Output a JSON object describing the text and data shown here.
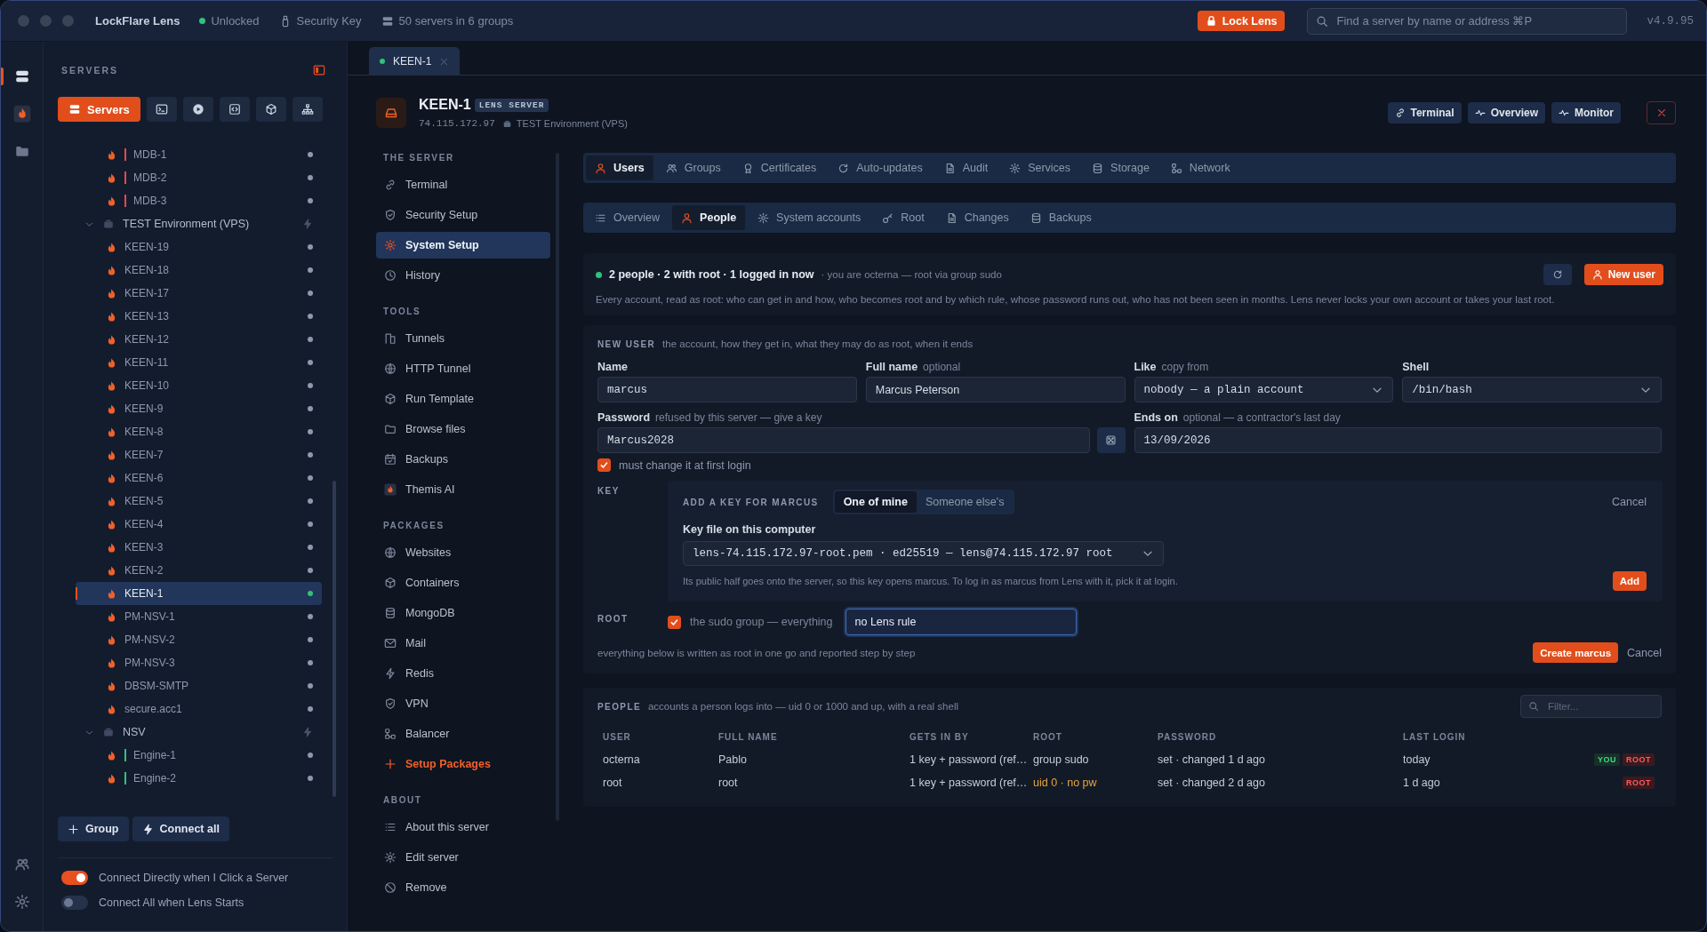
{
  "titlebar": {
    "app_name": "LockFlare Lens",
    "status": "Unlocked",
    "key_label": "Security Key",
    "servers_summary": "50 servers in 6 groups",
    "lock_button": "Lock Lens",
    "search": {
      "placeholder": "Find a server by name or address ⌘P"
    },
    "version": "v4.9.95"
  },
  "rail": [
    {
      "kind": "servers",
      "selected": true
    },
    {
      "kind": "themis",
      "selected": false
    },
    {
      "kind": "files",
      "selected": false
    }
  ],
  "rail_bottom": [
    {
      "kind": "people"
    },
    {
      "kind": "settings"
    }
  ],
  "sidebar": {
    "title": "SERVERS",
    "modes": [
      {
        "kind": "servers",
        "label": "Servers",
        "selected": true
      },
      {
        "kind": "terminal",
        "selected": false
      },
      {
        "kind": "play",
        "selected": false
      },
      {
        "kind": "code",
        "selected": false
      },
      {
        "kind": "cube",
        "selected": false
      },
      {
        "kind": "hierarchy",
        "selected": false
      }
    ],
    "tree": [
      {
        "kind": "server",
        "name": "MDB-1",
        "color": "#e5484d",
        "connected": false,
        "selected": false
      },
      {
        "kind": "server",
        "name": "MDB-2",
        "color": "#e5484d",
        "connected": false,
        "selected": false
      },
      {
        "kind": "server",
        "name": "MDB-3",
        "color": "#e5484d",
        "connected": false,
        "selected": false
      },
      {
        "kind": "group",
        "name": "TEST Environment (VPS)",
        "expanded": true,
        "children": [
          {
            "kind": "server",
            "name": "KEEN-19",
            "connected": false,
            "selected": false
          },
          {
            "kind": "server",
            "name": "KEEN-18",
            "connected": false,
            "selected": false
          },
          {
            "kind": "server",
            "name": "KEEN-17",
            "connected": false,
            "selected": false
          },
          {
            "kind": "server",
            "name": "KEEN-13",
            "connected": false,
            "selected": false
          },
          {
            "kind": "server",
            "name": "KEEN-12",
            "connected": false,
            "selected": false
          },
          {
            "kind": "server",
            "name": "KEEN-11",
            "connected": false,
            "selected": false
          },
          {
            "kind": "server",
            "name": "KEEN-10",
            "connected": false,
            "selected": false
          },
          {
            "kind": "server",
            "name": "KEEN-9",
            "connected": false,
            "selected": false
          },
          {
            "kind": "server",
            "name": "KEEN-8",
            "connected": false,
            "selected": false
          },
          {
            "kind": "server",
            "name": "KEEN-7",
            "connected": false,
            "selected": false
          },
          {
            "kind": "server",
            "name": "KEEN-6",
            "connected": false,
            "selected": false
          },
          {
            "kind": "server",
            "name": "KEEN-5",
            "connected": false,
            "selected": false
          },
          {
            "kind": "server",
            "name": "KEEN-4",
            "connected": false,
            "selected": false
          },
          {
            "kind": "server",
            "name": "KEEN-3",
            "connected": false,
            "selected": false
          },
          {
            "kind": "server",
            "name": "KEEN-2",
            "connected": false,
            "selected": false
          },
          {
            "kind": "server",
            "name": "KEEN-1",
            "connected": true,
            "selected": true
          },
          {
            "kind": "server",
            "name": "PM-NSV-1",
            "connected": false,
            "selected": false
          },
          {
            "kind": "server",
            "name": "PM-NSV-2",
            "connected": false,
            "selected": false
          },
          {
            "kind": "server",
            "name": "PM-NSV-3",
            "connected": false,
            "selected": false
          },
          {
            "kind": "server",
            "name": "DBSM-SMTP",
            "connected": false,
            "selected": false
          },
          {
            "kind": "server",
            "name": "secure.acc1",
            "connected": false,
            "selected": false
          }
        ]
      },
      {
        "kind": "group",
        "name": "NSV",
        "expanded": true,
        "children": [
          {
            "kind": "server",
            "name": "Engine-1",
            "color": "#2fc27a",
            "connected": false,
            "selected": false
          },
          {
            "kind": "server",
            "name": "Engine-2",
            "color": "#2fc27a",
            "connected": false,
            "selected": false
          }
        ]
      }
    ],
    "buttons": [
      {
        "kind": "plus",
        "label": "Group"
      },
      {
        "kind": "bolt",
        "label": "Connect all"
      }
    ],
    "toggles": [
      {
        "label": "Connect Directly when I Click a Server",
        "on": true
      },
      {
        "label": "Connect All when Lens Starts",
        "on": false
      }
    ]
  },
  "tabs": [
    {
      "label": "KEEN-1",
      "selected": true
    }
  ],
  "server": {
    "name": "KEEN-1",
    "badge": "LENS SERVER",
    "address": "74.115.172.97",
    "group": "TEST Environment (VPS)",
    "actions": [
      {
        "kind": "link",
        "label": "Terminal"
      },
      {
        "kind": "pulse",
        "label": "Overview"
      },
      {
        "kind": "pulse",
        "label": "Monitor"
      }
    ]
  },
  "nav": [
    {
      "title": "THE SERVER",
      "items": [
        {
          "kind": "link",
          "label": "Terminal",
          "selected": false
        },
        {
          "kind": "shield",
          "label": "Security Setup",
          "selected": false
        },
        {
          "kind": "gear",
          "label": "System Setup",
          "selected": true
        },
        {
          "kind": "clock",
          "label": "History",
          "selected": false
        }
      ]
    },
    {
      "title": "TOOLS",
      "items": [
        {
          "kind": "door",
          "label": "Tunnels",
          "selected": false
        },
        {
          "kind": "globe",
          "label": "HTTP Tunnel",
          "selected": false
        },
        {
          "kind": "cube",
          "label": "Run Template",
          "selected": false
        },
        {
          "kind": "folder",
          "label": "Browse files",
          "selected": false
        },
        {
          "kind": "calendar",
          "label": "Backups",
          "selected": false
        },
        {
          "kind": "themis",
          "label": "Themis AI",
          "selected": false
        }
      ]
    },
    {
      "title": "PACKAGES",
      "items": [
        {
          "kind": "globe",
          "label": "Websites",
          "selected": false
        },
        {
          "kind": "cube",
          "label": "Containers",
          "selected": false
        },
        {
          "kind": "database",
          "label": "MongoDB",
          "selected": false
        },
        {
          "kind": "mail",
          "label": "Mail",
          "selected": false
        },
        {
          "kind": "bolt",
          "label": "Redis",
          "selected": false
        },
        {
          "kind": "shield",
          "label": "VPN",
          "selected": false
        },
        {
          "kind": "nodes",
          "label": "Balancer",
          "selected": false
        },
        {
          "kind": "add",
          "label": "Setup Packages",
          "selected": false
        }
      ]
    },
    {
      "title": "ABOUT",
      "items": [
        {
          "kind": "list",
          "label": "About this server",
          "selected": false
        },
        {
          "kind": "gear",
          "label": "Edit server",
          "selected": false
        },
        {
          "kind": "ban",
          "label": "Remove",
          "selected": false
        }
      ]
    }
  ],
  "section_tabs": [
    {
      "kind": "person",
      "label": "Users",
      "selected": true
    },
    {
      "kind": "people",
      "label": "Groups",
      "selected": false
    },
    {
      "kind": "award",
      "label": "Certificates",
      "selected": false
    },
    {
      "kind": "refresh",
      "label": "Auto-updates",
      "selected": false
    },
    {
      "kind": "doc",
      "label": "Audit",
      "selected": false
    },
    {
      "kind": "gear",
      "label": "Services",
      "selected": false
    },
    {
      "kind": "database",
      "label": "Storage",
      "selected": false
    },
    {
      "kind": "nodes",
      "label": "Network",
      "selected": false
    }
  ],
  "sub_tabs": [
    {
      "kind": "list",
      "label": "Overview",
      "selected": false
    },
    {
      "kind": "person",
      "label": "People",
      "selected": true
    },
    {
      "kind": "gear",
      "label": "System accounts",
      "selected": false
    },
    {
      "kind": "key",
      "label": "Root",
      "selected": false
    },
    {
      "kind": "doc",
      "label": "Changes",
      "selected": false
    },
    {
      "kind": "database",
      "label": "Backups",
      "selected": false
    }
  ],
  "summary": {
    "headline": "2 people · 2 with root · 1 logged in now",
    "detail": "· you are octerna — root via group sudo",
    "description": "Every account, read as root: who can get in and how, who becomes root and by which rule, whose password runs out, who has not been seen in months. Lens never locks your own account or takes your last root.",
    "new_user_button": "New user"
  },
  "new_user": {
    "title": "NEW USER",
    "hint": "the account, how they get in, what they may do as root, when it ends",
    "fields": [
      {
        "label": "Name",
        "value": "marcus",
        "kind": "mono"
      },
      {
        "label": "Full name",
        "hint": "optional",
        "value": "Marcus Peterson",
        "kind": "text"
      },
      {
        "label": "Like",
        "hint": "copy from",
        "value": "nobody — a plain account",
        "kind": "select"
      },
      {
        "label": "Shell",
        "value": "/bin/bash",
        "kind": "select"
      }
    ],
    "password": {
      "label": "Password",
      "hint": "refused by this server — give a key",
      "value": "Marcus2028"
    },
    "ends_on": {
      "label": "Ends on",
      "hint": "optional — a contractor's last day",
      "value": "13/09/2026"
    },
    "must_change": {
      "label": "must change it at first login",
      "checked": true
    },
    "key": {
      "label": "KEY",
      "title": "ADD A KEY FOR MARCUS",
      "choices": [
        {
          "label": "One of mine",
          "selected": true
        },
        {
          "label": "Someone else's",
          "selected": false
        }
      ],
      "cancel": "Cancel",
      "file_label": "Key file on this computer",
      "file": "lens-74.115.172.97-root.pem · ed25519 — lens@74.115.172.97 root",
      "note": "Its public half goes onto the server, so this key opens marcus. To log in as marcus from Lens with it, pick it at login.",
      "add_button": "Add"
    },
    "root": {
      "label": "ROOT",
      "option": "the sudo group — everything",
      "checked": true,
      "rule": "no Lens rule",
      "focused": true
    },
    "footer_note": "everything below is written as root in one go and reported step by step",
    "create_button": "Create marcus",
    "cancel_button": "Cancel"
  },
  "people": {
    "title": "PEOPLE",
    "hint": "accounts a person logs into — uid 0 or 1000 and up, with a real shell",
    "filter": {
      "placeholder": "Filter..."
    },
    "columns": [
      "USER",
      "FULL NAME",
      "GETS IN BY",
      "ROOT",
      "PASSWORD",
      "LAST LOGIN"
    ],
    "rows": [
      {
        "user": "octerna",
        "full_name": "Pablo",
        "gets_in_by": "1 key + password (ref…",
        "root": "group sudo",
        "root_warning": false,
        "password": "set · changed 1 d ago",
        "last_login": "today",
        "badges": [
          {
            "kind": "you",
            "label": "YOU"
          },
          {
            "kind": "root",
            "label": "ROOT"
          }
        ]
      },
      {
        "user": "root",
        "full_name": "root",
        "gets_in_by": "1 key + password (ref…",
        "root": "uid 0 · no pw",
        "root_warning": true,
        "password": "set · changed 2 d ago",
        "last_login": "1 d ago",
        "badges": [
          {
            "kind": "root",
            "label": "ROOT"
          }
        ]
      }
    ]
  }
}
